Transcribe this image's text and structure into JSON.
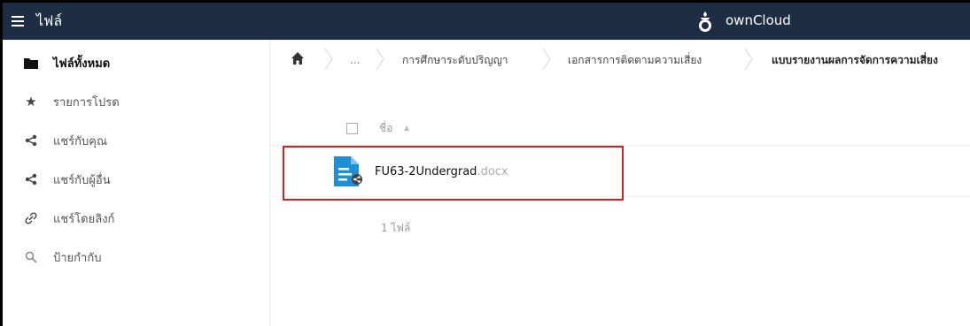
{
  "header": {
    "menu_icon": "hamburger-icon",
    "title": "ไฟล์",
    "logo_icon": "owncloud-logo-icon",
    "brand": "ownCloud",
    "bg_color": "#1d2d44"
  },
  "sidebar": {
    "items": [
      {
        "label": "ไฟล์ทั้งหมด",
        "icon": "folder-icon",
        "active": true
      },
      {
        "label": "รายการโปรด",
        "icon": "star-icon",
        "active": false
      },
      {
        "label": "แชร์กับคุณ",
        "icon": "share-icon",
        "active": false
      },
      {
        "label": "แชร์กับผู้อื่น",
        "icon": "share-icon",
        "active": false
      },
      {
        "label": "แชร์โดยลิงก์",
        "icon": "link-icon",
        "active": false
      },
      {
        "label": "ป้ายกำกับ",
        "icon": "search-icon",
        "active": false
      }
    ]
  },
  "breadcrumb": {
    "home_icon": "home-icon",
    "ellipsis": "...",
    "items": [
      "การศึกษาระดับปริญญา",
      "เอกสารการติดตามความเสี่ยง",
      "แบบรายงานผลการจัดการความเสี่ยง"
    ]
  },
  "list": {
    "header_name": "ชื่อ",
    "sort_icon": "sort-ascending-icon",
    "files": [
      {
        "name": "FU63-2Undergrad",
        "ext": ".docx",
        "icon": "document-icon",
        "shared": true
      }
    ],
    "summary": "1 ไฟล์"
  },
  "colors": {
    "highlight": "#d42020",
    "file_icon": "#1e90d6"
  }
}
